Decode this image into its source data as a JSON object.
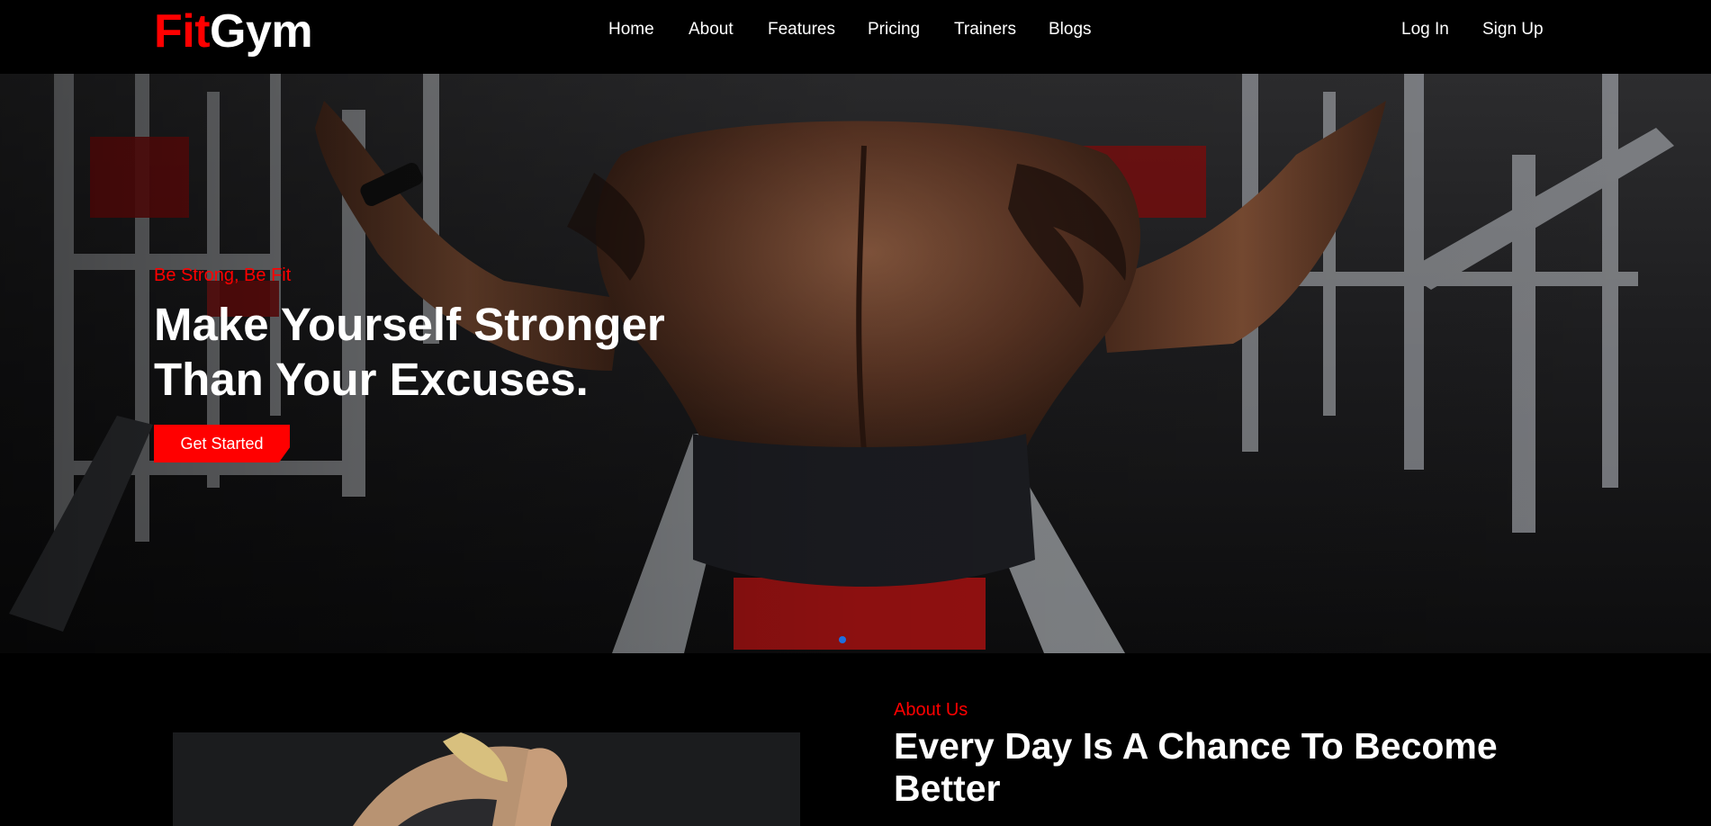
{
  "brand": {
    "part1": "Fit",
    "part2": "Gym",
    "accent_color": "#ff0000"
  },
  "nav": {
    "items": [
      {
        "label": "Home"
      },
      {
        "label": "About"
      },
      {
        "label": "Features"
      },
      {
        "label": "Pricing"
      },
      {
        "label": "Trainers"
      },
      {
        "label": "Blogs"
      }
    ],
    "login": "Log In",
    "signup": "Sign Up"
  },
  "hero": {
    "tagline": "Be Strong, Be Fit",
    "title_line1": "Make Yourself Stronger",
    "title_line2": "Than Your Excuses.",
    "cta": "Get Started",
    "carousel_indicator_color": "#1e6fe0"
  },
  "about": {
    "tagline": "About Us",
    "title": "Every Day Is A Chance To Become Better"
  }
}
